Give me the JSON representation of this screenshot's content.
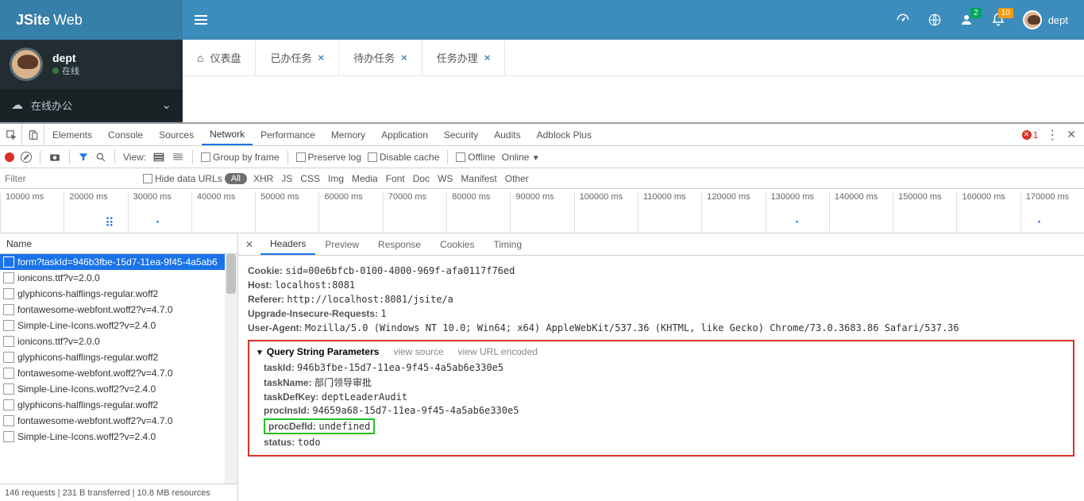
{
  "header": {
    "logo_bold": "JSite",
    "logo_light": "Web",
    "user_label": "dept",
    "badge_green": "2",
    "badge_orange": "10"
  },
  "sidebar": {
    "user_name": "dept",
    "status": "在线",
    "menu_label": "在线办公"
  },
  "tabs": [
    {
      "label": "仪表盘",
      "closable": false,
      "icon": "home"
    },
    {
      "label": "已办任务",
      "closable": true
    },
    {
      "label": "待办任务",
      "closable": true
    },
    {
      "label": "任务办理",
      "closable": true
    }
  ],
  "devtools": {
    "tabs": [
      "Elements",
      "Console",
      "Sources",
      "Network",
      "Performance",
      "Memory",
      "Application",
      "Security",
      "Audits",
      "Adblock Plus"
    ],
    "active_tab": "Network",
    "errors": "1",
    "toolbar": {
      "view_label": "View:",
      "group_by_frame": "Group by frame",
      "preserve_log": "Preserve log",
      "disable_cache": "Disable cache",
      "offline": "Offline",
      "online": "Online"
    },
    "filterbar": {
      "placeholder": "Filter",
      "hide_data_urls": "Hide data URLs",
      "all": "All",
      "types": [
        "XHR",
        "JS",
        "CSS",
        "Img",
        "Media",
        "Font",
        "Doc",
        "WS",
        "Manifest",
        "Other"
      ]
    },
    "timeline_ticks": [
      "10000 ms",
      "20000 ms",
      "30000 ms",
      "40000 ms",
      "50000 ms",
      "60000 ms",
      "70000 ms",
      "80000 ms",
      "90000 ms",
      "100000 ms",
      "110000 ms",
      "120000 ms",
      "130000 ms",
      "140000 ms",
      "150000 ms",
      "160000 ms",
      "170000 ms"
    ],
    "name_header": "Name",
    "requests": [
      "form?taskId=946b3fbe-15d7-11ea-9f45-4a5ab6",
      "ionicons.ttf?v=2.0.0",
      "glyphicons-halflings-regular.woff2",
      "fontawesome-webfont.woff2?v=4.7.0",
      "Simple-Line-Icons.woff2?v=2.4.0",
      "ionicons.ttf?v=2.0.0",
      "glyphicons-halflings-regular.woff2",
      "fontawesome-webfont.woff2?v=4.7.0",
      "Simple-Line-Icons.woff2?v=2.4.0",
      "glyphicons-halflings-regular.woff2",
      "fontawesome-webfont.woff2?v=4.7.0",
      "Simple-Line-Icons.woff2?v=2.4.0"
    ],
    "status_bar": "146 requests  |  231 B transferred  |  10.8 MB resources",
    "detail_tabs": [
      "Headers",
      "Preview",
      "Response",
      "Cookies",
      "Timing"
    ],
    "active_detail_tab": "Headers",
    "headers_general": [
      {
        "k": "Cookie:",
        "v": "sid=00e6bfcb-0100-4000-969f-afa0117f76ed"
      },
      {
        "k": "Host:",
        "v": "localhost:8081"
      },
      {
        "k": "Referer:",
        "v": "http://localhost:8081/jsite/a"
      },
      {
        "k": "Upgrade-Insecure-Requests:",
        "v": "1"
      },
      {
        "k": "User-Agent:",
        "v": "Mozilla/5.0 (Windows NT 10.0; Win64; x64) AppleWebKit/537.36 (KHTML, like Gecko) Chrome/73.0.3683.86 Safari/537.36"
      }
    ],
    "query_section": {
      "title": "Query String Parameters",
      "view_source": "view source",
      "view_url_encoded": "view URL encoded",
      "params": [
        {
          "k": "taskId:",
          "v": "946b3fbe-15d7-11ea-9f45-4a5ab6e330e5"
        },
        {
          "k": "taskName:",
          "v": "部门领导审批"
        },
        {
          "k": "taskDefKey:",
          "v": "deptLeaderAudit"
        },
        {
          "k": "procInsId:",
          "v": "94659a68-15d7-11ea-9f45-4a5ab6e330e5"
        },
        {
          "k": "procDefId:",
          "v": "undefined",
          "highlight": true
        },
        {
          "k": "status:",
          "v": "todo"
        }
      ]
    }
  }
}
